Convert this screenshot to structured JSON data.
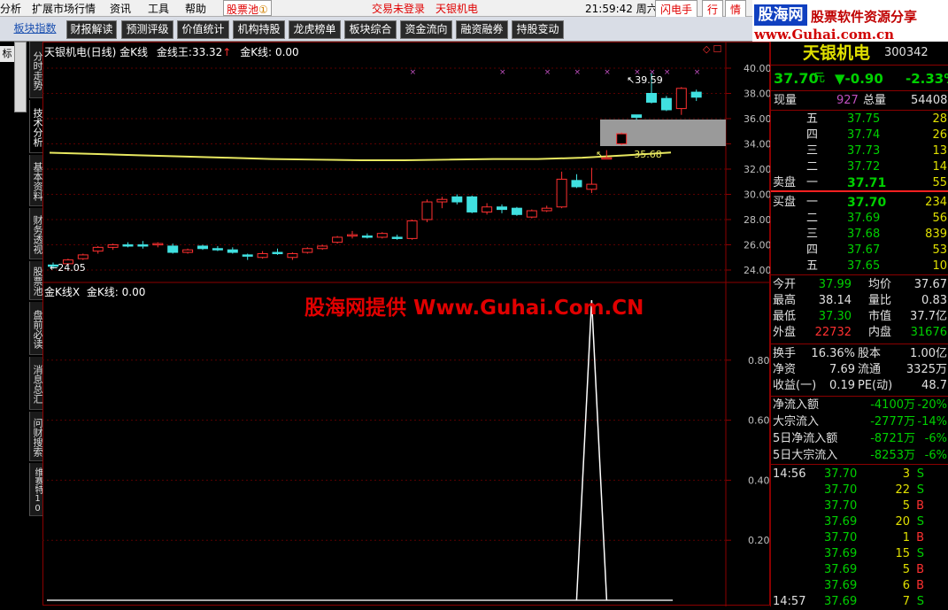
{
  "menu": {
    "items": [
      "分析",
      "扩展市场行情",
      "资讯",
      "工具",
      "帮助"
    ],
    "stock_pool": "股票池",
    "status": "交易未登录",
    "stock_name": "天银机电",
    "clock": "21:59:42 周六",
    "flash_order": "闪电手",
    "quote": "行",
    "info": "情"
  },
  "toolbar": {
    "items": [
      "板块指数",
      "财报解读",
      "预测评级",
      "价值统计",
      "机构持股",
      "龙虎榜单",
      "板块综合",
      "资金流向",
      "融资融券",
      "持股变动"
    ]
  },
  "banner": {
    "title": "股海网",
    "slogan": "股票软件资源分享",
    "url": "www.Guhai.com.cn"
  },
  "left_tabs": [
    "分时走势",
    "技术分析",
    "基本资料",
    "财务透视",
    "股票池",
    "盘前必读",
    "消息总汇",
    "问财搜索",
    "维赛特10"
  ],
  "left_edge": "标",
  "chart": {
    "upper_title": "天银机电(日线) 金K线",
    "upper_value_label": "金线王:",
    "upper_value": "33.32",
    "upper_k_label": "金K线:",
    "upper_k_value": "0.00",
    "lower_title": "金K线X",
    "lower_k_label": "金K线:",
    "lower_k_value": "0.00",
    "watermark": "股海网提供 Www.Guhai.Com.CN",
    "low_annot": "24.05",
    "high_annot": "39.59",
    "mid_annot": "35.68",
    "upper_ticks": [
      "40.00",
      "38.00",
      "36.00",
      "34.00",
      "32.00",
      "30.00",
      "28.00",
      "26.00",
      "24.00"
    ],
    "lower_ticks": [
      "0.80",
      "0.60",
      "0.40",
      "0.20"
    ]
  },
  "chart_data": {
    "type": "candlestick",
    "candles": [
      [
        24.4,
        24.6,
        24.1,
        24.3
      ],
      [
        24.5,
        24.9,
        24.4,
        24.8
      ],
      [
        24.9,
        25.3,
        24.8,
        25.2
      ],
      [
        25.5,
        25.9,
        25.3,
        25.8
      ],
      [
        25.8,
        26.1,
        25.6,
        26.0
      ],
      [
        26.0,
        26.2,
        25.8,
        25.9
      ],
      [
        26.0,
        26.3,
        25.7,
        25.9
      ],
      [
        26.0,
        26.2,
        25.8,
        26.1
      ],
      [
        25.9,
        26.1,
        25.3,
        25.4
      ],
      [
        25.4,
        25.7,
        25.3,
        25.6
      ],
      [
        25.9,
        26.0,
        25.6,
        25.7
      ],
      [
        25.7,
        25.9,
        25.5,
        25.6
      ],
      [
        25.6,
        25.8,
        25.3,
        25.4
      ],
      [
        25.2,
        25.3,
        24.8,
        25.1
      ],
      [
        25.0,
        25.5,
        24.9,
        25.3
      ],
      [
        25.4,
        25.7,
        25.2,
        25.3
      ],
      [
        25.0,
        25.4,
        24.8,
        25.3
      ],
      [
        25.4,
        25.8,
        25.3,
        25.7
      ],
      [
        25.7,
        26.0,
        25.6,
        25.9
      ],
      [
        26.2,
        26.7,
        26.1,
        26.6
      ],
      [
        26.7,
        27.1,
        26.5,
        26.8
      ],
      [
        26.7,
        26.9,
        26.5,
        26.6
      ],
      [
        26.6,
        27.0,
        26.5,
        26.9
      ],
      [
        26.6,
        26.8,
        26.4,
        26.5
      ],
      [
        26.5,
        28.0,
        26.4,
        27.9
      ],
      [
        28.0,
        29.6,
        27.8,
        29.4
      ],
      [
        29.4,
        29.8,
        28.9,
        29.6
      ],
      [
        29.8,
        30.0,
        29.2,
        29.4
      ],
      [
        29.8,
        29.9,
        28.5,
        28.6
      ],
      [
        28.6,
        29.3,
        28.4,
        29.0
      ],
      [
        29.0,
        29.2,
        28.5,
        28.8
      ],
      [
        28.9,
        29.0,
        28.3,
        28.4
      ],
      [
        28.2,
        28.8,
        28.1,
        28.7
      ],
      [
        28.7,
        29.1,
        28.6,
        28.9
      ],
      [
        29.0,
        31.8,
        28.9,
        31.2
      ],
      [
        31.1,
        31.6,
        30.5,
        30.6
      ],
      [
        30.4,
        32.1,
        30.1,
        30.8
      ],
      [
        32.9,
        33.5,
        32.8,
        32.9
      ],
      [
        34.0,
        34.9,
        33.9,
        34.8
      ],
      [
        36.3,
        36.3,
        35.9,
        36.1
      ],
      [
        38.0,
        39.6,
        37.2,
        37.3
      ],
      [
        37.6,
        37.8,
        36.6,
        36.7
      ],
      [
        36.8,
        38.5,
        36.3,
        38.4
      ],
      [
        38.1,
        38.3,
        37.4,
        37.7
      ]
    ],
    "gold_line": [
      33.3,
      33.2,
      33.1,
      33.0,
      32.9,
      32.8,
      32.75,
      32.7,
      32.7,
      32.75,
      32.8,
      32.8,
      32.9,
      33.1,
      33.32
    ],
    "marker_candles": [
      24,
      30,
      33,
      35,
      37,
      39,
      40,
      41,
      43
    ],
    "lower_signal": {
      "candle": 36,
      "value": 1.0
    },
    "ylim": [
      23,
      41
    ],
    "lower_ylim": [
      0,
      1
    ]
  },
  "panel": {
    "stock_name": "天银机电",
    "code": "300342",
    "price": "37.70",
    "price_unit": "元",
    "change": "▼-0.90",
    "change_pct": "-2.33%",
    "now_vol_label": "现量",
    "now_vol": "927",
    "total_vol_label": "总量",
    "total_vol": "54408",
    "sell_label": "卖盘",
    "buy_label": "买盘",
    "asks": [
      {
        "l": "五",
        "p": "37.75",
        "v": "28"
      },
      {
        "l": "四",
        "p": "37.74",
        "v": "26"
      },
      {
        "l": "三",
        "p": "37.73",
        "v": "13"
      },
      {
        "l": "二",
        "p": "37.72",
        "v": "14"
      },
      {
        "l": "一",
        "p": "37.71",
        "v": "55"
      }
    ],
    "bids": [
      {
        "l": "一",
        "p": "37.70",
        "v": "234"
      },
      {
        "l": "二",
        "p": "37.69",
        "v": "56"
      },
      {
        "l": "三",
        "p": "37.68",
        "v": "839"
      },
      {
        "l": "四",
        "p": "37.67",
        "v": "53"
      },
      {
        "l": "五",
        "p": "37.65",
        "v": "10"
      }
    ],
    "stats": [
      {
        "a": "今开",
        "av": "37.99",
        "b": "均价",
        "bv": "37.67"
      },
      {
        "a": "最高",
        "av": "38.14",
        "b": "量比",
        "bv": "0.83"
      },
      {
        "a": "最低",
        "av": "37.30",
        "b": "市值",
        "bv": "37.7亿"
      },
      {
        "a": "外盘",
        "av": "22732",
        "b": "内盘",
        "bv": "31676"
      }
    ],
    "stats2": [
      {
        "a": "换手",
        "av": "16.36%",
        "b": "股本",
        "bv": "1.00亿"
      },
      {
        "a": "净资",
        "av": "7.69",
        "b": "流通",
        "bv": "3325万"
      },
      {
        "a": "收益(一)",
        "av": "0.19",
        "b": "PE(动)",
        "bv": "48.7"
      }
    ],
    "flows": [
      {
        "a": "净流入额",
        "b": "-4100万",
        "c": "-20%"
      },
      {
        "a": "大宗流入",
        "b": "-2777万",
        "c": "-14%"
      },
      {
        "a": "5日净流入额",
        "b": "-8721万",
        "c": "-6%"
      },
      {
        "a": "5日大宗流入",
        "b": "-8253万",
        "c": "-6%"
      }
    ],
    "ticks": [
      {
        "t": "14:56",
        "p": "37.70",
        "v": "3",
        "s": "S"
      },
      {
        "t": "",
        "p": "37.70",
        "v": "22",
        "s": "S"
      },
      {
        "t": "",
        "p": "37.70",
        "v": "5",
        "s": "B"
      },
      {
        "t": "",
        "p": "37.69",
        "v": "20",
        "s": "S"
      },
      {
        "t": "",
        "p": "37.70",
        "v": "1",
        "s": "B"
      },
      {
        "t": "",
        "p": "37.69",
        "v": "15",
        "s": "S"
      },
      {
        "t": "",
        "p": "37.69",
        "v": "5",
        "s": "B"
      },
      {
        "t": "",
        "p": "37.69",
        "v": "6",
        "s": "B"
      },
      {
        "t": "14:57",
        "p": "37.69",
        "v": "7",
        "s": "S"
      }
    ]
  }
}
